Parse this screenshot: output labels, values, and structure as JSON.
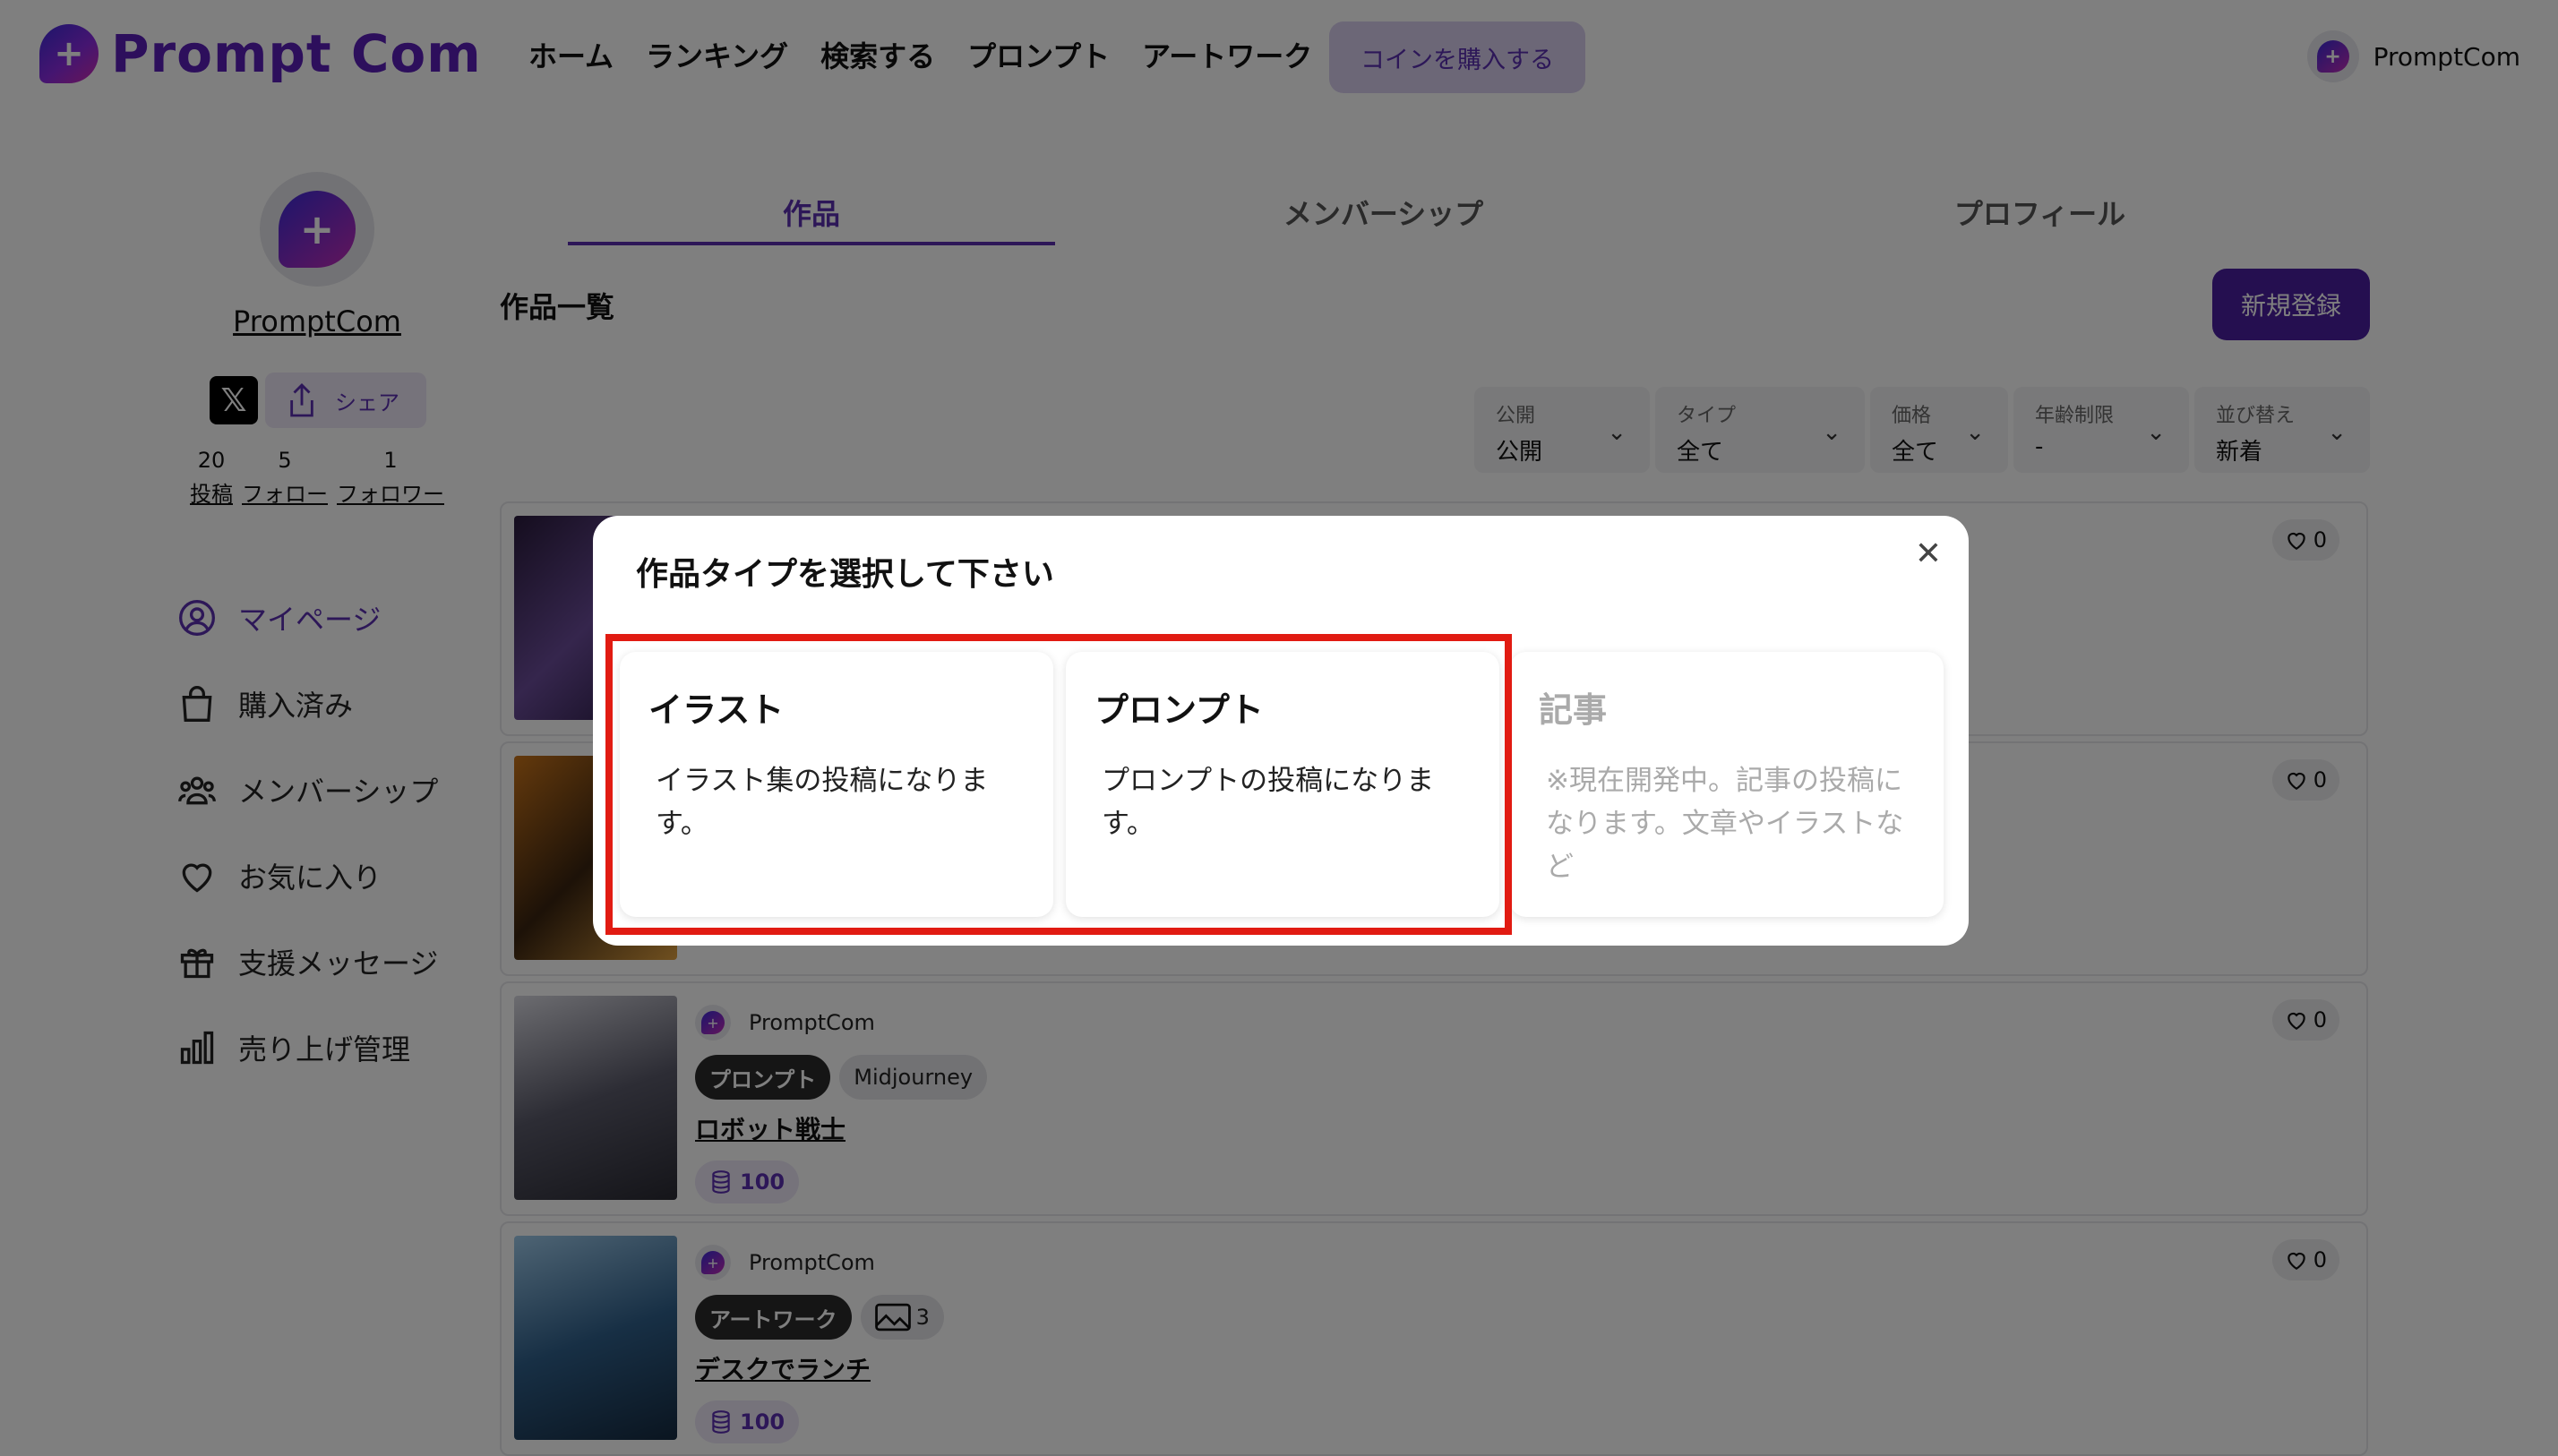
{
  "header": {
    "logo_text": "Prompt Com",
    "nav": [
      "ホーム",
      "ランキング",
      "検索する",
      "プロンプト",
      "アートワーク"
    ],
    "coin_button": "コインを購入する",
    "username": "PromptCom"
  },
  "profile": {
    "name": "PromptCom",
    "share_label": "シェア",
    "stats": [
      {
        "count": "20",
        "label": "投稿"
      },
      {
        "count": "5",
        "label": "フォロー"
      },
      {
        "count": "1",
        "label": "フォロワー"
      }
    ]
  },
  "sidebar": {
    "items": [
      {
        "label": "マイページ",
        "icon": "user-circle-icon"
      },
      {
        "label": "購入済み",
        "icon": "shopping-bag-icon"
      },
      {
        "label": "メンバーシップ",
        "icon": "users-icon"
      },
      {
        "label": "お気に入り",
        "icon": "heart-icon"
      },
      {
        "label": "支援メッセージ",
        "icon": "gift-icon"
      },
      {
        "label": "売り上げ管理",
        "icon": "bar-chart-icon"
      }
    ]
  },
  "tabs": [
    "作品",
    "メンバーシップ",
    "プロフィール"
  ],
  "main": {
    "section_title": "作品一覧",
    "new_button": "新規登録"
  },
  "filters": [
    {
      "label": "公開",
      "value": "公開"
    },
    {
      "label": "タイプ",
      "value": "全て"
    },
    {
      "label": "価格",
      "value": "全て"
    },
    {
      "label": "年齢制限",
      "value": "-"
    },
    {
      "label": "並び替え",
      "value": "新着"
    }
  ],
  "cards": [
    {
      "author": "PromptCom",
      "tags": [
        "プロンプト",
        "Midjourney"
      ],
      "title": "ロボット戦士",
      "price": "100",
      "likes": "0"
    },
    {
      "author": "PromptCom",
      "tags": [
        "アートワーク",
        "3"
      ],
      "title": "デスクでランチ",
      "price": "100",
      "likes": "0"
    }
  ],
  "hidden_likes": [
    "0",
    "0"
  ],
  "modal": {
    "title": "作品タイプを選択して下さい",
    "options": [
      {
        "title": "イラスト",
        "desc": "イラスト集の投稿になります。"
      },
      {
        "title": "プロンプト",
        "desc": "プロンプトの投稿になります。"
      },
      {
        "title": "記事",
        "desc": "※現在開発中。記事の投稿になります。文章やイラストなど"
      }
    ]
  },
  "colors": {
    "accent": "#5a2fb0",
    "highlight": "#e11b12"
  }
}
